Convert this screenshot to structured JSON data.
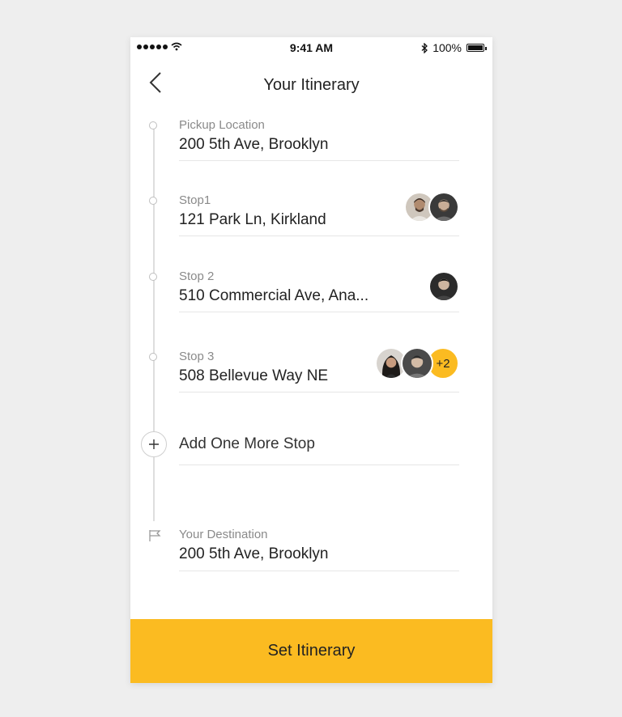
{
  "status_bar": {
    "time": "9:41 AM",
    "battery": "100%",
    "icons": [
      "signal-dots-icon",
      "wifi-icon",
      "bluetooth-icon",
      "battery-icon"
    ]
  },
  "header": {
    "title": "Your Itinerary",
    "back_icon": "chevron-left-icon"
  },
  "itinerary": {
    "pickup": {
      "label": "Pickup Location",
      "address": "200 5th Ave, Brooklyn"
    },
    "stops": [
      {
        "label": "Stop1",
        "address": "121 Park Ln, Kirkland",
        "avatar_count": 2
      },
      {
        "label": "Stop 2",
        "address": "510 Commercial Ave, Ana...",
        "avatar_count": 1
      },
      {
        "label": "Stop 3",
        "address": "508 Bellevue Way NE",
        "avatar_count": 2,
        "extra": "+2"
      }
    ],
    "add_stop": {
      "label": "Add One More Stop",
      "icon": "plus-icon"
    },
    "destination": {
      "label": "Your Destination",
      "address": "200 5th Ave, Brooklyn",
      "icon": "flag-icon"
    }
  },
  "cta": {
    "label": "Set Itinerary"
  },
  "colors": {
    "accent": "#fbbb21",
    "divider": "#e6e6e6",
    "label_gray": "#8a8a8a",
    "text": "#222222"
  }
}
